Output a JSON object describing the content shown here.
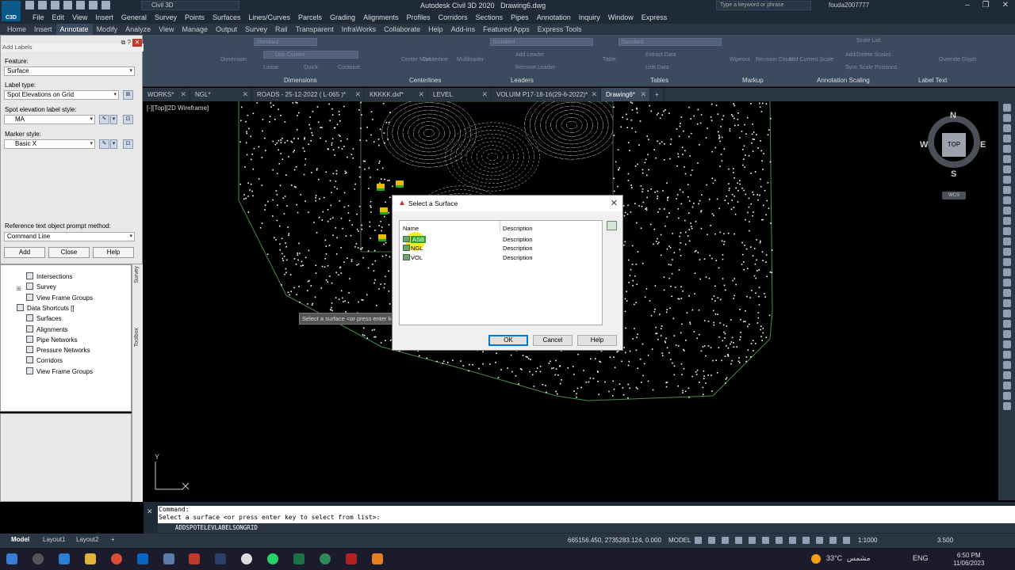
{
  "titlebar": {
    "workspace": "Civil 3D",
    "app_title": "Autodesk Civil 3D 2020",
    "file_name": "Drawing6.dwg",
    "search_placeholder": "Type a keyword or phrase",
    "user": "fouda2007777",
    "logo_text": "C3D"
  },
  "menu": [
    "File",
    "Edit",
    "View",
    "Insert",
    "General",
    "Survey",
    "Points",
    "Surfaces",
    "Lines/Curves",
    "Parcels",
    "Grading",
    "Alignments",
    "Profiles",
    "Corridors",
    "Sections",
    "Pipes",
    "Annotation",
    "Inquiry",
    "Window",
    "Express"
  ],
  "ribbon_tabs": [
    "Home",
    "Insert",
    "Annotate",
    "Modify",
    "Analyze",
    "View",
    "Manage",
    "Output",
    "Survey",
    "Rail",
    "Transparent",
    "InfraWorks",
    "Collaborate",
    "Help",
    "Add-ins",
    "Featured Apps",
    "Express Tools"
  ],
  "ribbon_active_tab": "Annotate",
  "ribbon": {
    "dim_style": "Standard",
    "dim_layer": "Use Current",
    "mleader_style": "Standard",
    "table_style": "Standard",
    "panels": {
      "dimensions": "Dimensions",
      "centerlines": "Centerlines",
      "leaders": "Leaders",
      "tables": "Tables",
      "markup": "Markup",
      "annotation_scaling": "Annotation Scaling",
      "label_text": "Label Text"
    },
    "tools": {
      "dimension": "Dimension",
      "linear": "Linear",
      "quick": "Quick",
      "continue": "Continue",
      "center_mark": "Center Mark",
      "centerline": "Centerline",
      "multileader": "Multileader",
      "add_leader": "Add Leader",
      "remove_leader": "Remove Leader",
      "table": "Table",
      "extract_data": "Extract Data",
      "link_data": "Link Data",
      "wipeout": "Wipeout",
      "revision_cloud": "Revision Cloud",
      "add_current_scale": "Add Current Scale",
      "scale_list": "Scale List",
      "add_delete_scales": "Add/Delete Scales",
      "sync_scale_positions": "Sync Scale Positions",
      "override_glyph": "Override Glyph"
    }
  },
  "doc_tabs": [
    {
      "label": "WORKS*"
    },
    {
      "label": "NGL*"
    },
    {
      "label": "ROADS - 25-12-2022 ( L-065 )*"
    },
    {
      "label": "KKKKK.dxf*"
    },
    {
      "label": "LEVEL"
    },
    {
      "label": "VOLUIM P17-18-16(29-6-2022)*"
    },
    {
      "label": "Drawing6*"
    }
  ],
  "viewport": {
    "label": "[-][Top][2D Wireframe]",
    "tooltip": "Select a surface <or press enter key to select from list>",
    "axis_y": "Y"
  },
  "viewcube": {
    "n": "N",
    "s": "S",
    "e": "E",
    "w": "W",
    "top": "TOP",
    "wcs": "WCS"
  },
  "add_labels": {
    "title": "Add Labels",
    "feature_label": "Feature:",
    "feature_value": "Surface",
    "label_type_label": "Label type:",
    "label_type_value": "Spot Elevations on Grid",
    "spot_style_label": "Spot elevation label style:",
    "spot_style_value": "MA",
    "marker_style_label": "Marker style:",
    "marker_style_value": "Basic X",
    "ref_label": "Reference text object prompt method:",
    "ref_value": "Command Line",
    "add_button": "Add",
    "close_button": "Close",
    "help_button": "Help"
  },
  "toolspace": {
    "items": [
      {
        "label": "Intersections",
        "indent": 2
      },
      {
        "label": "Survey",
        "indent": 2
      },
      {
        "label": "View Frame Groups",
        "indent": 2
      },
      {
        "label": "Data Shortcuts []",
        "indent": 1
      },
      {
        "label": "Surfaces",
        "indent": 2
      },
      {
        "label": "Alignments",
        "indent": 2
      },
      {
        "label": "Pipe Networks",
        "indent": 2
      },
      {
        "label": "Pressure Networks",
        "indent": 2
      },
      {
        "label": "Corridors",
        "indent": 2
      },
      {
        "label": "View Frame Groups",
        "indent": 2
      }
    ],
    "side_tabs": [
      "Survey",
      "Toolbox"
    ]
  },
  "dialog": {
    "title": "Select a Surface",
    "col_name": "Name",
    "col_description": "Description",
    "rows": [
      {
        "name": "ASB",
        "description": "Description",
        "selected": true
      },
      {
        "name": "NGL",
        "description": "Description",
        "selected": false
      },
      {
        "name": "VOL",
        "description": "Description",
        "selected": false
      }
    ],
    "ok": "OK",
    "cancel": "Cancel",
    "help": "Help"
  },
  "command": {
    "line1": "Command:",
    "line2": "Select a surface <or press enter key to select from list>:",
    "input": "ADDSPOTELEVLABELSONGRID"
  },
  "status": {
    "tabs": [
      "Model",
      "Layout1",
      "Layout2"
    ],
    "coords": "665156.450, 2735283.124, 0.000",
    "mode": "MODEL",
    "scale": "1:1000",
    "zoom": "3.500"
  },
  "taskbar": {
    "weather": "33°C",
    "weather_text": "مشمس",
    "lang": "ENG",
    "time": "6:50 PM",
    "date": "11/06/2023"
  }
}
